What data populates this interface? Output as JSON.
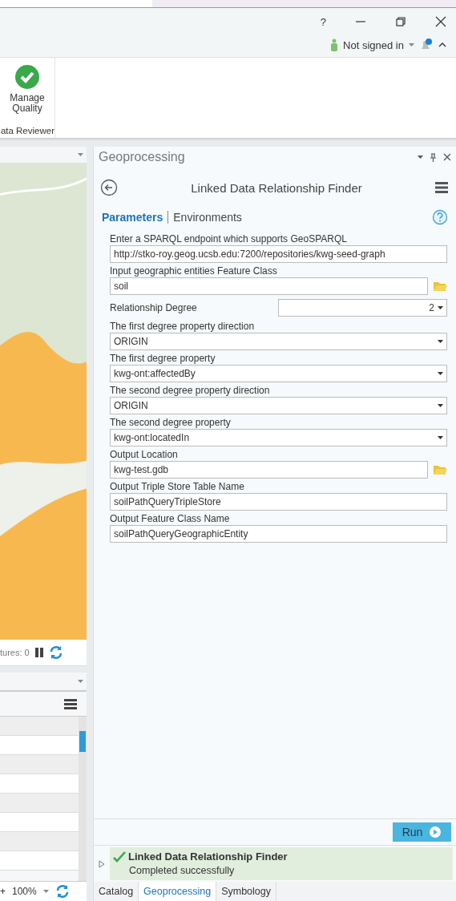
{
  "title_bar": {
    "help": "?"
  },
  "account": {
    "label": "Not signed in"
  },
  "ribbon": {
    "button": "Manage\nQuality",
    "group_label": "ata Reviewer"
  },
  "map_status": {
    "features": "tures: 0"
  },
  "attribute_table": {
    "zoom": "100%",
    "zoom_in": "+"
  },
  "geoprocessing": {
    "title": "Geoprocessing",
    "tool_title": "Linked Data Relationship Finder",
    "tabs": [
      {
        "label": "Parameters",
        "selected": true
      },
      {
        "label": "Environments",
        "selected": false
      }
    ],
    "parameters": [
      {
        "kind": "text",
        "label": "Enter a SPARQL endpoint which supports GeoSPARQL",
        "value": "http://stko-roy.geog.ucsb.edu:7200/repositories/kwg-seed-graph"
      },
      {
        "kind": "browse",
        "label": "Input geographic entities Feature Class",
        "value": "soil"
      },
      {
        "kind": "inline",
        "label": "Relationship Degree",
        "value": "2"
      },
      {
        "kind": "dropdown",
        "label": "The first degree property direction",
        "value": "ORIGIN"
      },
      {
        "kind": "dropdown",
        "label": "The first degree property",
        "value": "kwg-ont:affectedBy"
      },
      {
        "kind": "dropdown",
        "label": "The second degree property direction",
        "value": "ORIGIN"
      },
      {
        "kind": "dropdown",
        "label": "The second degree property",
        "value": "kwg-ont:locatedIn"
      },
      {
        "kind": "browse",
        "label": "Output Location",
        "value": "kwg-test.gdb"
      },
      {
        "kind": "text",
        "label": "Output Triple Store Table Name",
        "value": "soilPathQueryTripleStore"
      },
      {
        "kind": "text",
        "label": "Output Feature Class Name",
        "value": "soilPathQueryGeographicEntity"
      }
    ],
    "run_button": "Run",
    "message": {
      "title": "Linked Data Relationship Finder",
      "status": "Completed successfully"
    }
  },
  "bottom_tabs": [
    {
      "label": "Catalog",
      "selected": false
    },
    {
      "label": "Geoprocessing",
      "selected": true
    },
    {
      "label": "Symbology",
      "selected": false
    }
  ]
}
